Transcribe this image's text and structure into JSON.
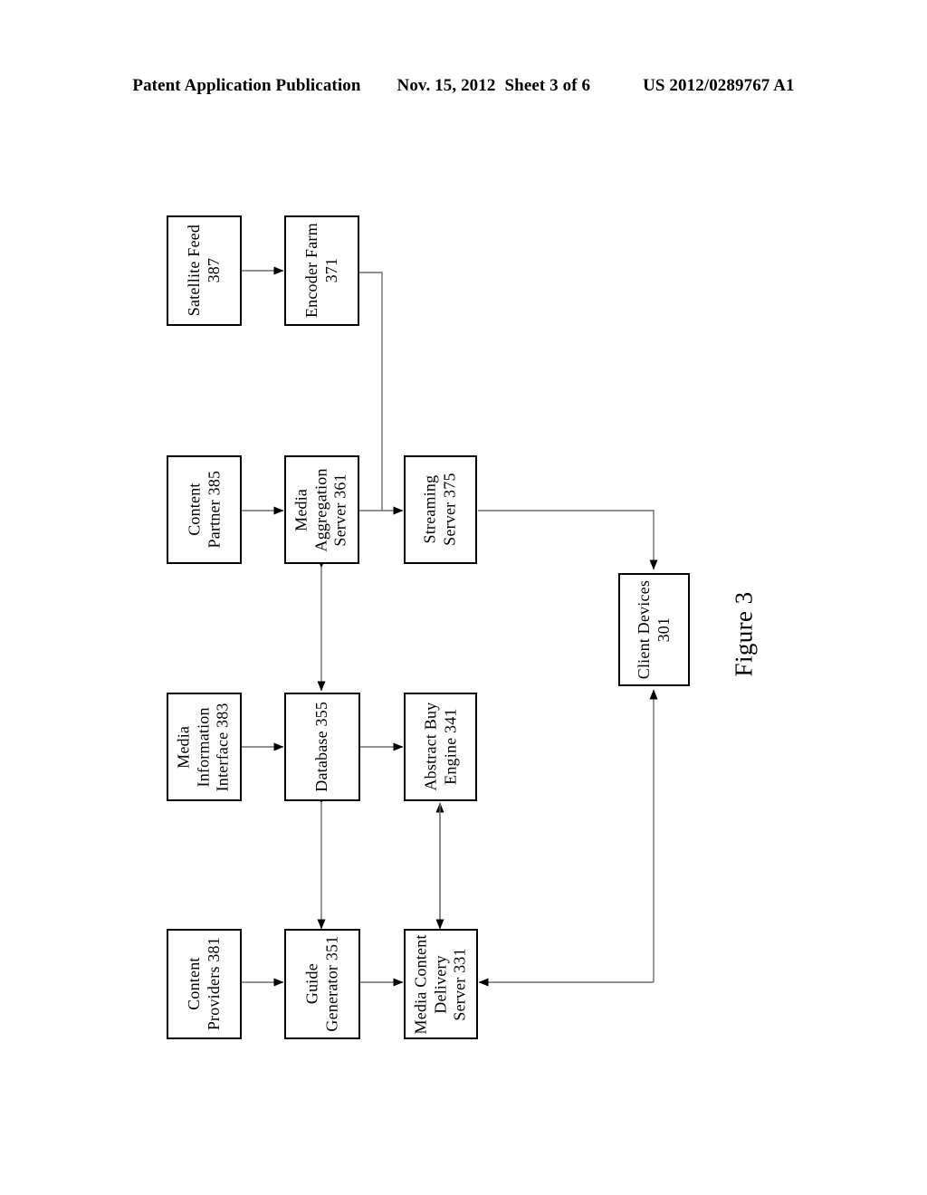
{
  "header": {
    "publication": "Patent Application Publication",
    "date": "Nov. 15, 2012",
    "sheet": "Sheet 3 of 6",
    "number": "US 2012/0289767 A1"
  },
  "figure": {
    "caption": "Figure 3"
  },
  "nodes": {
    "satellite_feed": "Satellite Feed\n387",
    "encoder_farm": "Encoder Farm\n371",
    "content_partner": "Content\nPartner 385",
    "media_aggregation_server": "Media\nAggregation\nServer 361",
    "streaming_server": "Streaming\nServer 375",
    "media_information_interface": "Media\nInformation\nInterface 383",
    "database": "Database 355",
    "abstract_buy_engine": "Abstract Buy\nEngine 341",
    "content_providers": "Content\nProviders 381",
    "guide_generator": "Guide\nGenerator 351",
    "media_content_delivery_server": "Media Content\nDelivery\nServer 331",
    "client_devices": "Client Devices\n301"
  },
  "colors": {
    "ink": "#000000",
    "paper": "#ffffff",
    "wire": "#6e6e6e"
  }
}
